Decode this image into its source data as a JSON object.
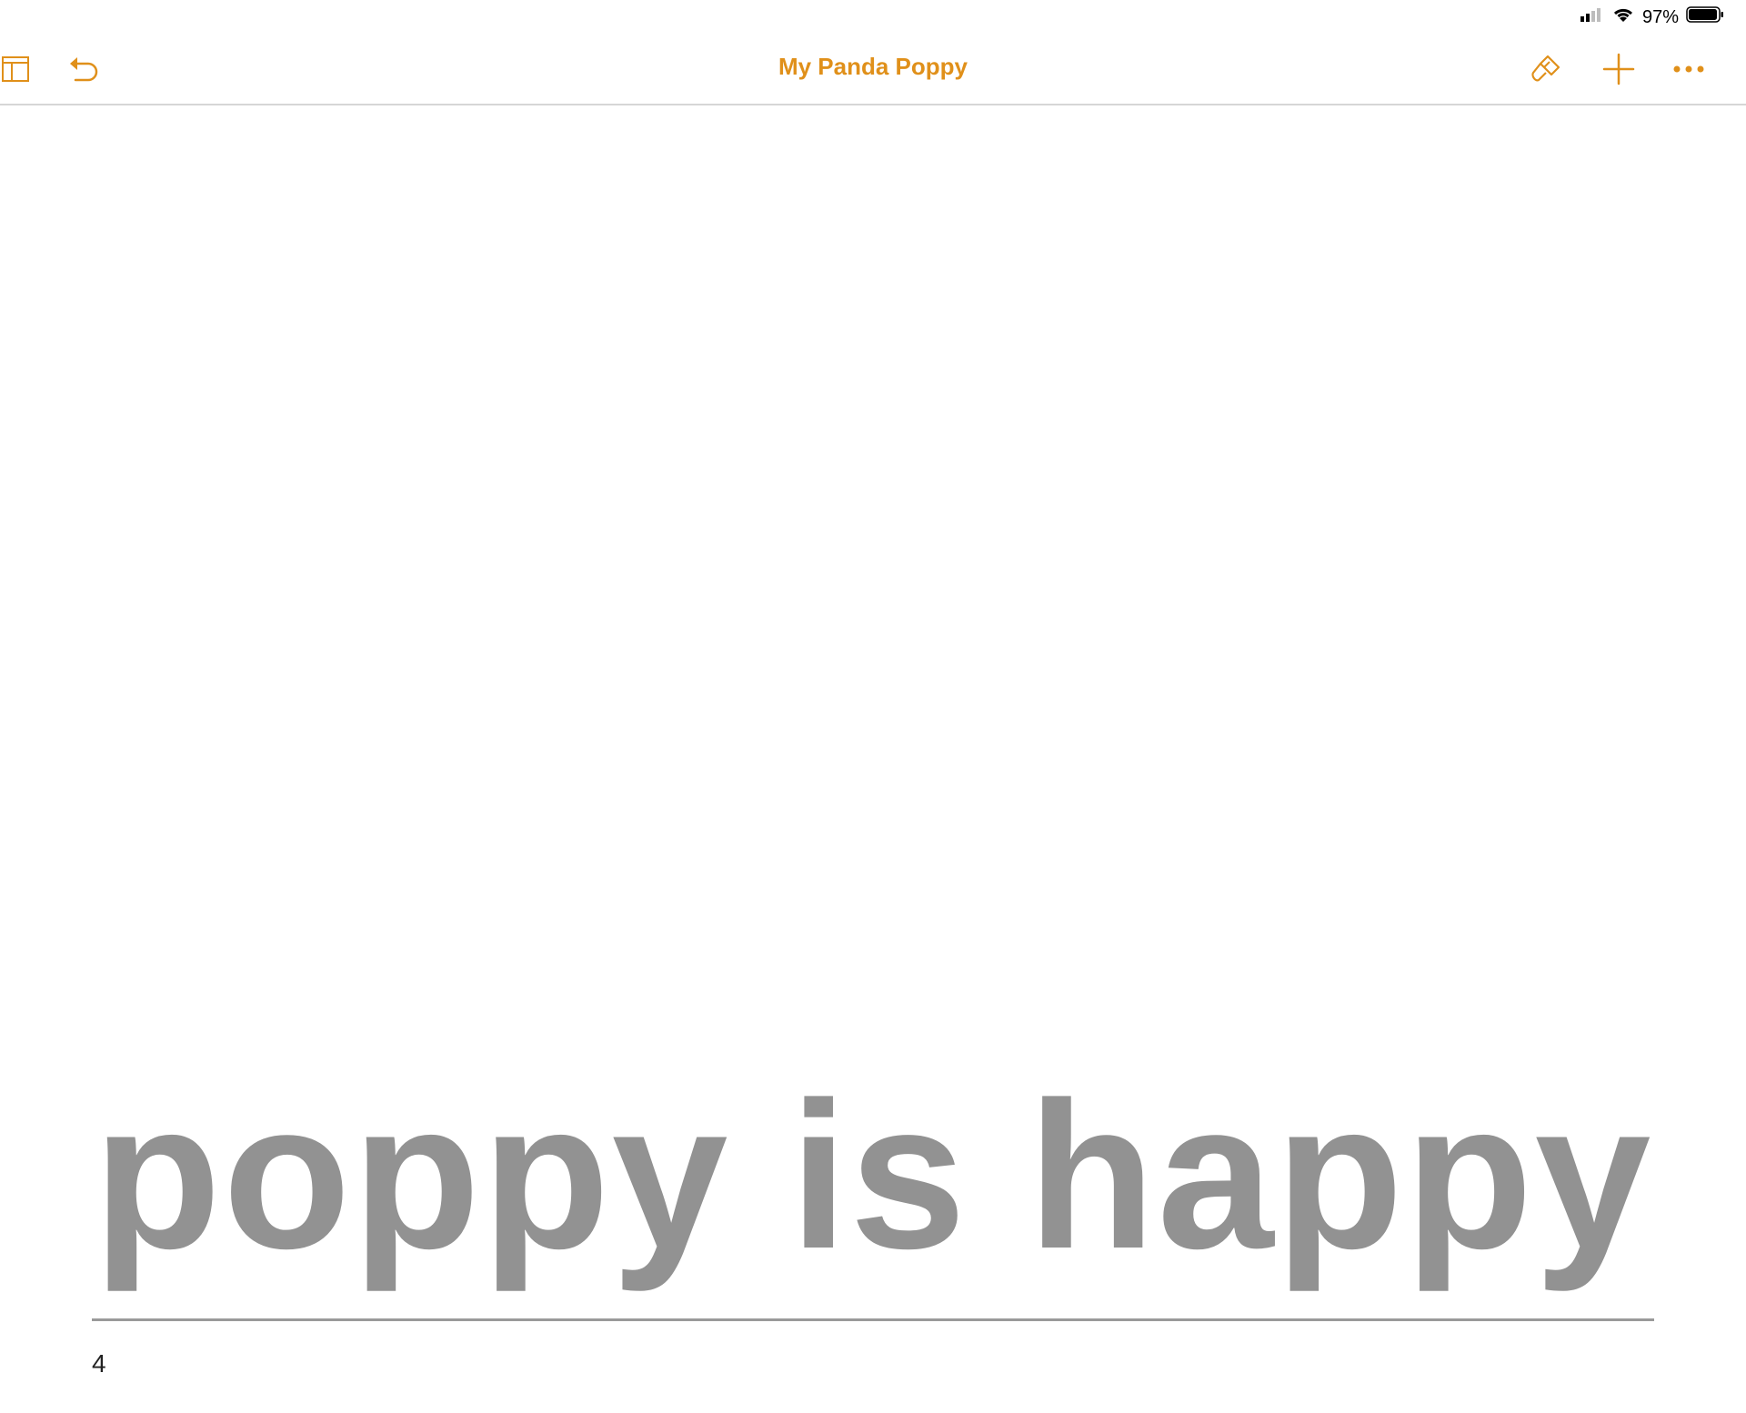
{
  "status_bar": {
    "battery_percent": "97%",
    "battery_level": 0.97,
    "icons": [
      "signal-icon",
      "wifi-icon",
      "battery-icon"
    ]
  },
  "toolbar": {
    "title": "My Panda Poppy",
    "accent_color": "#e0901a",
    "left_icons": [
      "sidebar-icon",
      "undo-icon"
    ],
    "right_icons": [
      "format-brush-icon",
      "add-icon",
      "more-icon"
    ]
  },
  "page": {
    "body_text": "poppy is happy",
    "body_text_color": "#929292",
    "page_number": "4"
  }
}
